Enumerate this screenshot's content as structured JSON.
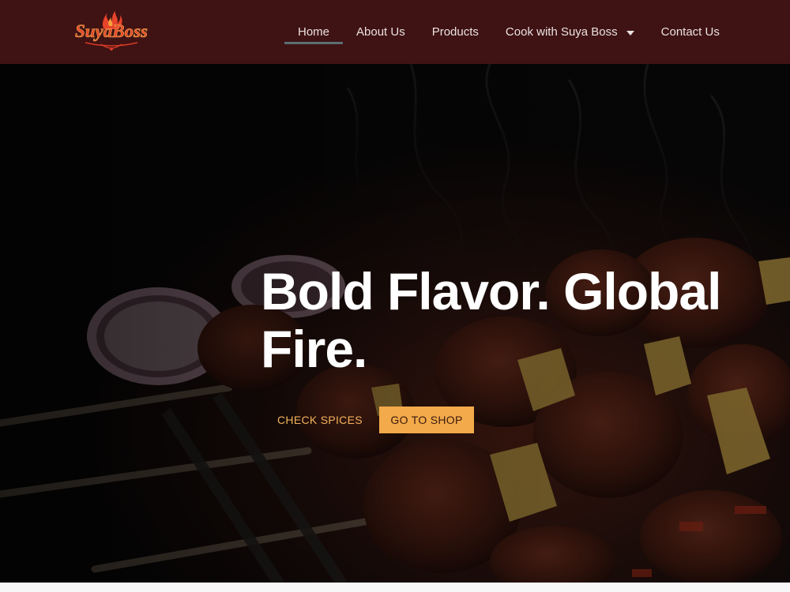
{
  "brand": {
    "logo_text": "SuyaBoss",
    "logo_icon": "flame-icon",
    "colors": {
      "header_bg": "#3f1213",
      "accent": "#f2aa4a",
      "logo_red": "#e0422a"
    }
  },
  "nav": {
    "items": [
      {
        "label": "Home",
        "active": true
      },
      {
        "label": "About Us"
      },
      {
        "label": "Products"
      },
      {
        "label": "Cook with Suya Boss",
        "has_dropdown": true,
        "icon": "caret-down-icon"
      },
      {
        "label": "Contact Us"
      }
    ]
  },
  "hero": {
    "headline": "Bold Flavor. Global Fire.",
    "primary_button": "CHECK SPICES",
    "secondary_button": "GO TO SHOP",
    "background_image": "grilled suya skewers with onion and peppers"
  }
}
